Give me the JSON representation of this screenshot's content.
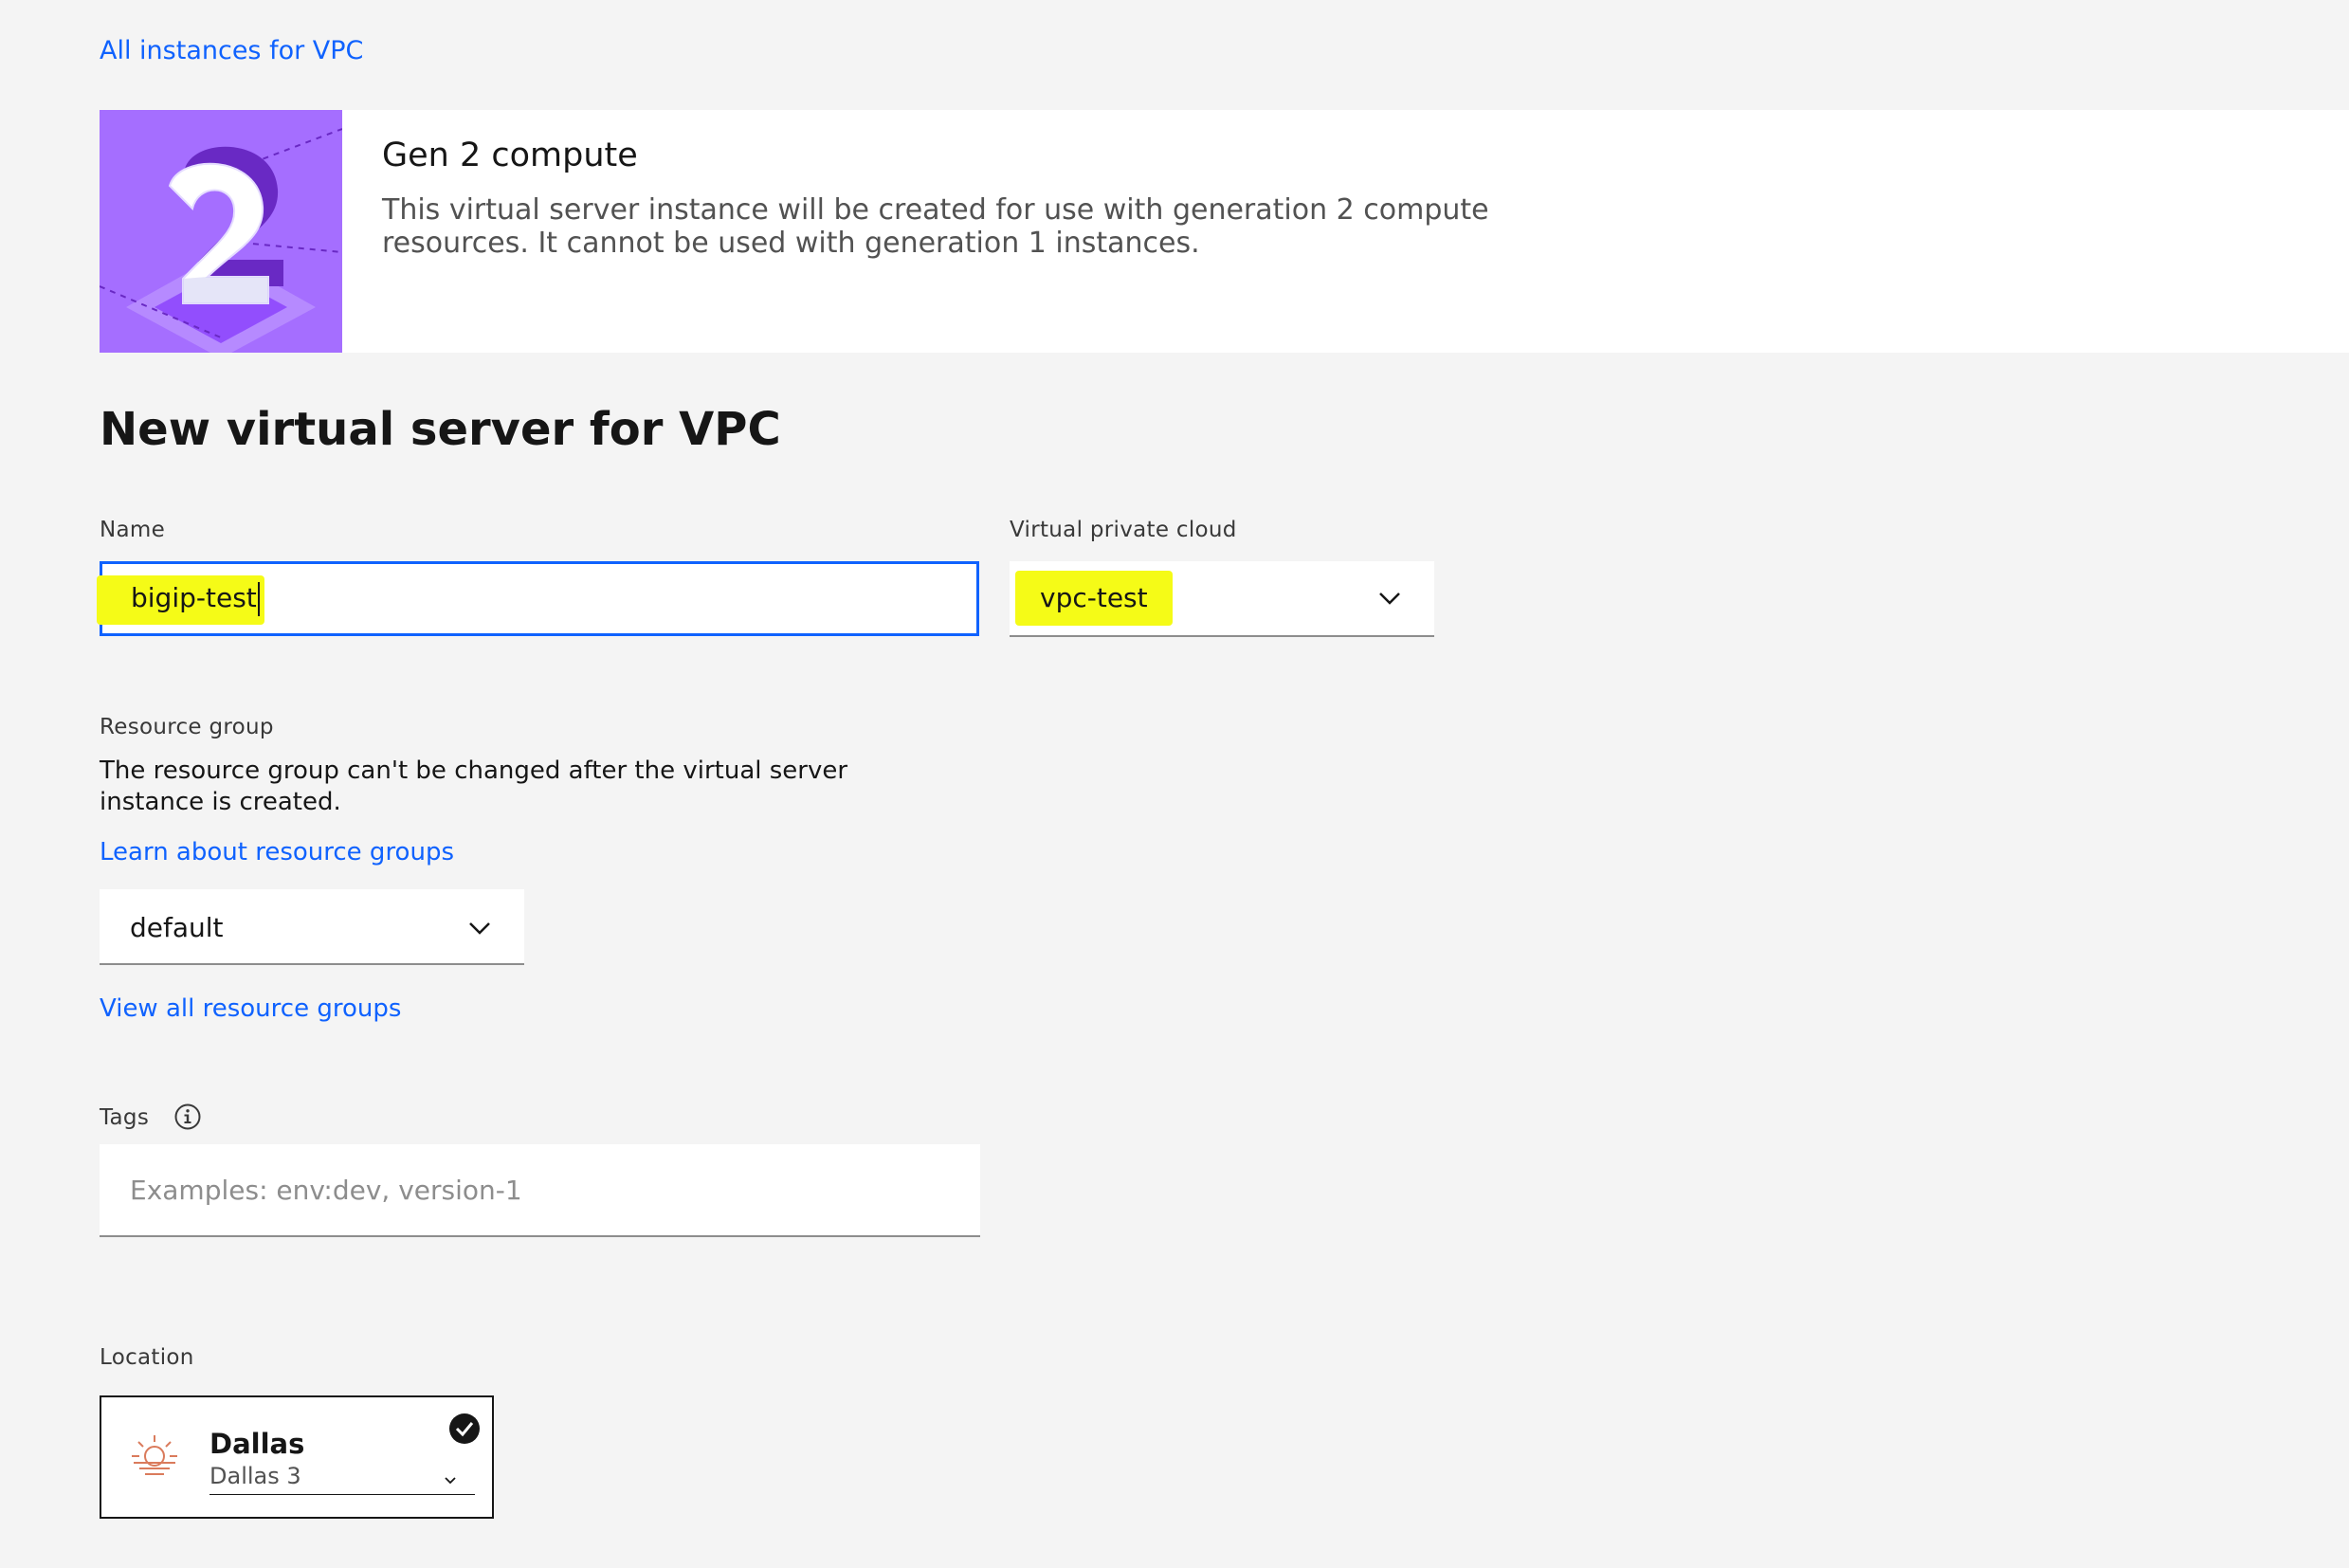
{
  "breadcrumb": {
    "label": "All instances for VPC"
  },
  "banner": {
    "title": "Gen 2 compute",
    "description": "This virtual server instance will be created for use with generation 2 compute resources. It cannot be used with generation 1 instances.",
    "image_icon": "gen2-illustration",
    "image_color": "#a56eff"
  },
  "page": {
    "title": "New virtual server for VPC"
  },
  "form": {
    "name": {
      "label": "Name",
      "value": "bigip-test"
    },
    "vpc": {
      "label": "Virtual private cloud",
      "value": "vpc-test"
    },
    "resource_group": {
      "label": "Resource group",
      "help": "The resource group can't be changed after the virtual server instance is created.",
      "learn_link": "Learn about resource groups",
      "value": "default",
      "view_all_link": "View all resource groups"
    },
    "tags": {
      "label": "Tags",
      "placeholder": "Examples: env:dev, version-1",
      "info_icon": "info-icon"
    },
    "location": {
      "label": "Location",
      "region": "Dallas",
      "zone": "Dallas 3",
      "region_icon": "sun-icon",
      "selected_icon": "checkmark-filled-icon"
    }
  },
  "colors": {
    "link": "#0f62fe",
    "highlight": "#f5fb17",
    "background": "#f4f4f4",
    "focus_border": "#0f62fe"
  }
}
